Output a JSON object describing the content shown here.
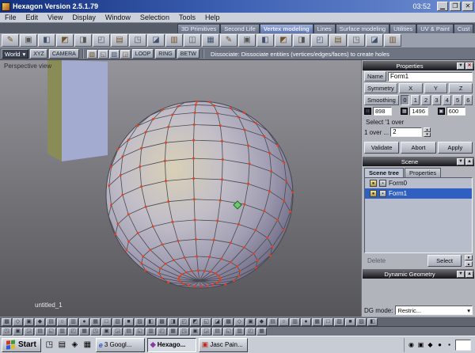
{
  "window": {
    "title": "Hexagon Version 2.5.1.79",
    "clock": "03:52"
  },
  "menu": {
    "items": [
      "File",
      "Edit",
      "View",
      "Display",
      "Window",
      "Selection",
      "Tools",
      "Help"
    ]
  },
  "tabs": {
    "items": [
      {
        "label": "3D Primitives"
      },
      {
        "label": "Second Life"
      },
      {
        "label": "Vertex modeling"
      },
      {
        "label": "Lines"
      },
      {
        "label": "Surface modeling"
      },
      {
        "label": "Utilities"
      },
      {
        "label": "UV & Paint"
      },
      {
        "label": "Cust"
      }
    ]
  },
  "toolbar": {
    "world": "World",
    "xyz": "XYZ",
    "camera": "CAMERA",
    "loop": "LOOP",
    "ring": "RING",
    "betw": "BETW",
    "status": "Dissociate: Dissociate entities (vertices/edges/faces) to create holes"
  },
  "viewport": {
    "label": "Perspective view",
    "doc": "untitled_1"
  },
  "properties": {
    "header": "Properties",
    "name_label": "Name",
    "name_value": "Form1",
    "symmetry_label": "Symmetry",
    "axes": [
      "X",
      "Y",
      "Z"
    ],
    "smoothing_label": "Smoothing",
    "levels": [
      "0",
      "1",
      "2",
      "3",
      "4",
      "5",
      "6"
    ],
    "counts": [
      {
        "value": "898"
      },
      {
        "value": "1496"
      },
      {
        "value": "600"
      }
    ],
    "select_header": "Select '1 over",
    "one_over_label": "1 over ...",
    "one_over_value": "2",
    "validate": "Validate",
    "abort": "Abort",
    "apply": "Apply"
  },
  "scene": {
    "header": "Scene",
    "tab_tree": "Scene tree",
    "tab_props": "Properties",
    "items": [
      {
        "name": "Form0"
      },
      {
        "name": "Form1"
      }
    ],
    "delete_label": "Delete",
    "select_label": "Select"
  },
  "dynamic": {
    "header": "Dynamic Geometry",
    "dg_label": "DG mode:",
    "dg_value": "Restric..."
  },
  "taskbar": {
    "start": "Start",
    "tasks": [
      {
        "label": "3 Googl..."
      },
      {
        "label": "Hexago..."
      },
      {
        "label": "Jasc Pain..."
      }
    ]
  }
}
